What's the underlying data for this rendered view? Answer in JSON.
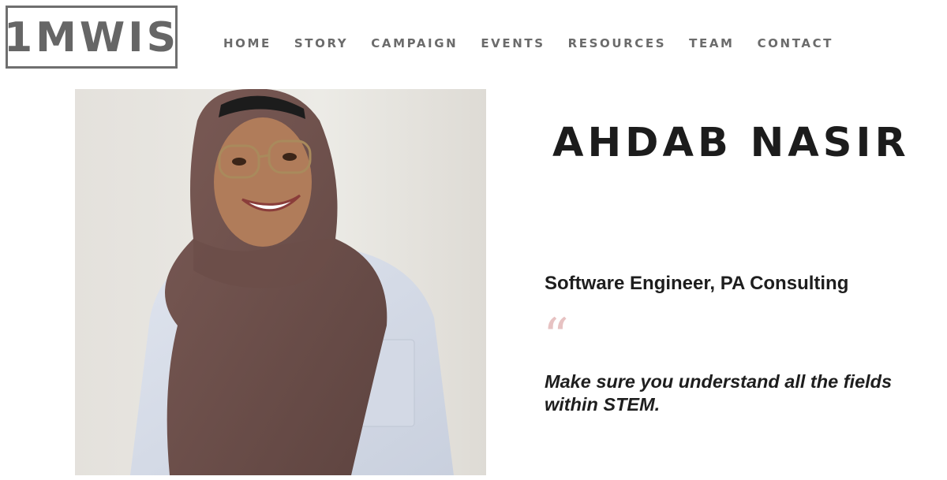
{
  "header": {
    "logo_text": "1MWIS",
    "nav": [
      "HOME",
      "STORY",
      "CAMPAIGN",
      "EVENTS",
      "RESOURCES",
      "TEAM",
      "CONTACT"
    ]
  },
  "profile": {
    "name": "AHDAB NASIR",
    "role": "Software Engineer, PA Consulting",
    "quote_mark": "“",
    "quote": "Make sure you understand all the fields within STEM."
  },
  "colors": {
    "logo": "#6f6f6f",
    "nav_text": "#6b6b6b",
    "quote_mark": "#e7c2c2",
    "headline": "#1c1c1c"
  }
}
